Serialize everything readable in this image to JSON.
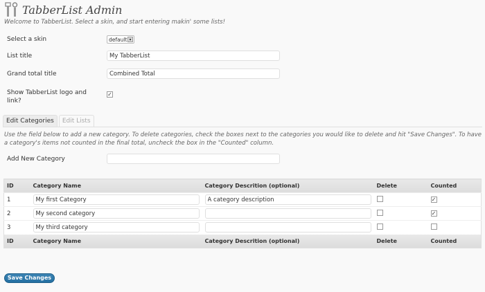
{
  "header": {
    "title": "TabberList Admin",
    "intro": "Welcome to TabberList. Select a skin, and start entering makin' some lists!"
  },
  "settings": {
    "skin_label": "Select a skin",
    "skin_value": "default",
    "list_title_label": "List title",
    "list_title_value": "My TabberList",
    "grand_total_label": "Grand total title",
    "grand_total_value": "Combined Total",
    "logo_label": "Show TabberList logo and link?",
    "logo_checked": true
  },
  "tabs": [
    {
      "label": "Edit Categories"
    },
    {
      "label": "Edit Lists"
    }
  ],
  "instructions": "Use the field below to add a new category. To delete categories, check the boxes next to the categories you would like to delete and hit \"Save Changes\". To have a category's items not counted in the final total, uncheck the box in the \"Counted\" column.",
  "add_category": {
    "label": "Add New Category",
    "value": ""
  },
  "table": {
    "columns": [
      "ID",
      "Category Name",
      "Category Descrition (optional)",
      "Delete",
      "Counted"
    ],
    "rows": [
      {
        "id": "1",
        "name": "My first Category",
        "description": "A category description",
        "delete": false,
        "counted": true
      },
      {
        "id": "2",
        "name": "My second category",
        "description": "",
        "delete": false,
        "counted": true
      },
      {
        "id": "3",
        "name": "My third category",
        "description": "",
        "delete": false,
        "counted": false
      }
    ]
  },
  "save_label": "Save Changes"
}
